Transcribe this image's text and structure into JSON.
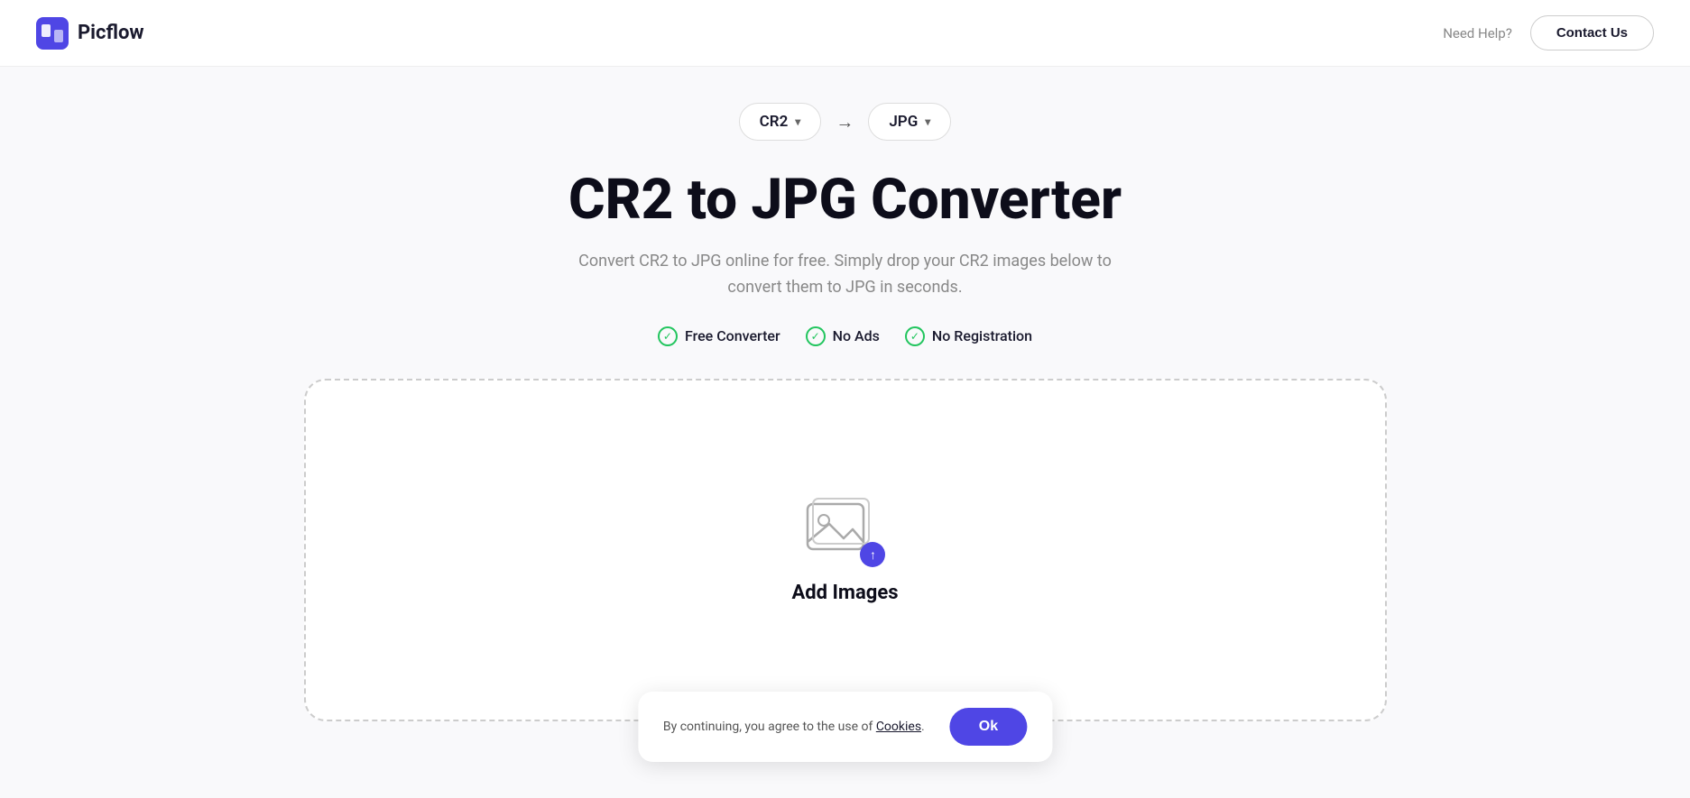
{
  "header": {
    "logo_text": "Picflow",
    "need_help_label": "Need Help?",
    "contact_us_label": "Contact Us"
  },
  "format_selector": {
    "from_format": "CR2",
    "to_format": "JPG",
    "arrow": "→"
  },
  "hero": {
    "title": "CR2 to JPG Converter",
    "subtitle": "Convert CR2 to JPG online for free. Simply drop your CR2 images below to convert them to JPG in seconds.",
    "badge1": "Free Converter",
    "badge2": "No Ads",
    "badge3": "No Registration"
  },
  "dropzone": {
    "add_images_label": "Add Images"
  },
  "cookie": {
    "text": "By continuing, you agree to the use of",
    "link_text": "Cookies",
    "ok_label": "Ok"
  },
  "colors": {
    "accent": "#4f46e5",
    "green": "#22c55e"
  }
}
